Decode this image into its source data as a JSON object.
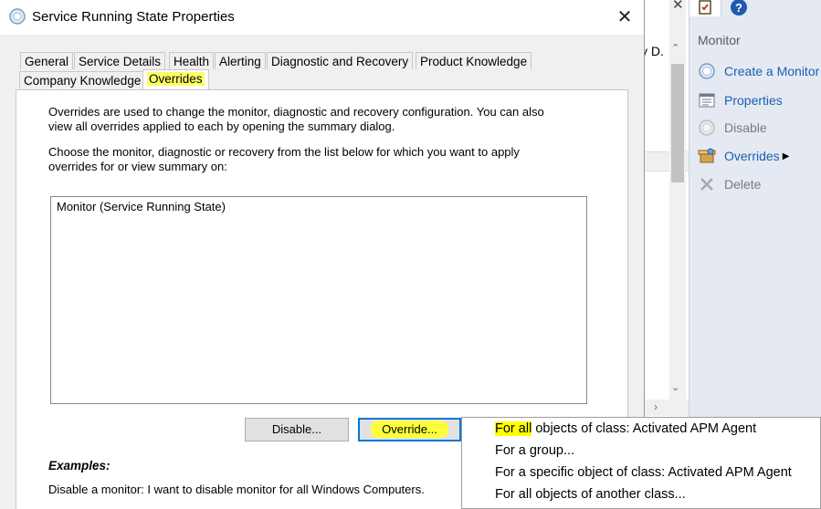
{
  "dialog": {
    "title": "Service Running State Properties",
    "tabs_row1": [
      "General",
      "Service Details",
      "Health",
      "Alerting",
      "Diagnostic and Recovery",
      "Product Knowledge"
    ],
    "tabs_row2": [
      "Company Knowledge",
      "Overrides"
    ],
    "selected_tab": "Overrides",
    "description_line1": "Overrides are used to change the monitor, diagnostic and recovery configuration. You can also",
    "description_line2": "view all overrides applied to each by opening the summary dialog.",
    "choose_line1": "Choose the monitor, diagnostic or recovery from the list below for which you want to apply",
    "choose_line2": "overrides for or view summary on:",
    "list_items": [
      "Monitor (Service Running State)"
    ],
    "disable_button": "Disable...",
    "override_button": "Override...",
    "examples_heading": "Examples:",
    "example_text": "Disable a monitor: I want to disable monitor for all Windows Computers.",
    "close_glyph": "✕"
  },
  "context_menu": {
    "items": [
      {
        "highlight": "For all",
        "rest": " objects of class: Activated APM Agent"
      },
      {
        "highlight": "",
        "rest": "For a group..."
      },
      {
        "highlight": "",
        "rest": "For a specific object of class: Activated APM Agent"
      },
      {
        "highlight": "",
        "rest": "For all objects of another class..."
      }
    ]
  },
  "background": {
    "truncated_text": "y D.",
    "close_glyph": "✕"
  },
  "actions_pane": {
    "title": "Monitor",
    "items": [
      {
        "label": "Create a Monitor",
        "icon": "create-monitor-icon",
        "enabled": true
      },
      {
        "label": "Properties",
        "icon": "properties-icon",
        "enabled": true
      },
      {
        "label": "Disable",
        "icon": "disable-icon",
        "enabled": false
      },
      {
        "label": "Overrides",
        "icon": "overrides-icon",
        "enabled": true,
        "submenu": true
      },
      {
        "label": "Delete",
        "icon": "delete-icon",
        "enabled": false
      }
    ]
  },
  "colors": {
    "highlight": "#ffff00",
    "link": "#1a5fb4",
    "default_button_border": "#0078d7"
  }
}
